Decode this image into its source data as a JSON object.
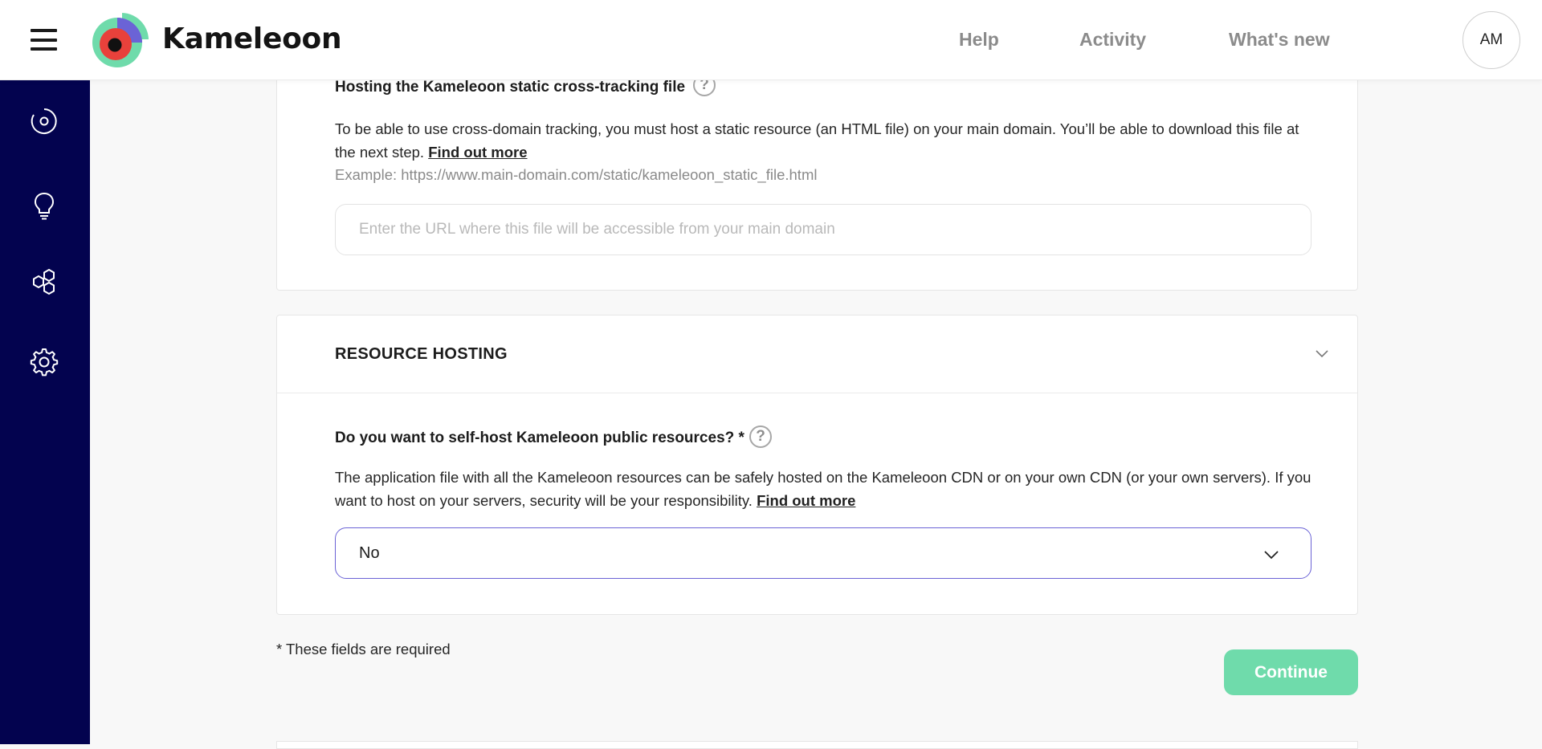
{
  "topbar": {
    "brand": "Kameleoon",
    "nav": {
      "help": "Help",
      "activity": "Activity",
      "whats_new": "What's new"
    },
    "avatar_initials": "AM"
  },
  "sidebar": {
    "icons": [
      "target-icon",
      "lightbulb-icon",
      "hexagons-icon",
      "gear-icon"
    ]
  },
  "cross_tracking": {
    "heading": "Hosting the Kameleoon static cross-tracking file",
    "description": "To be able to use cross-domain tracking, you must host a static resource (an HTML file) on your main domain. You’ll be able to download this file at the next step.",
    "find_out_more": "Find out more",
    "example": "Example: https://www.main-domain.com/static/kameleoon_static_file.html",
    "url_input": {
      "value": "",
      "placeholder": "Enter the URL where this file will be accessible from your main domain"
    }
  },
  "resource_hosting": {
    "title": "RESOURCE HOSTING",
    "question": "Do you want to self-host Kameleoon public resources? *",
    "help_glyph": "?",
    "description": "The application file with all the Kameleoon resources can be safely hosted on the Kameleoon CDN or on your own CDN (or your own servers). If you want to host on your servers, security will be your responsibility.",
    "find_out_more": "Find out more",
    "select_value": "No"
  },
  "footer": {
    "required_note": "* These fields are required",
    "continue_label": "Continue"
  },
  "colors": {
    "sidebar_bg": "#03034f",
    "continue_bg": "#6fdbab",
    "select_border": "#6b63d6"
  }
}
